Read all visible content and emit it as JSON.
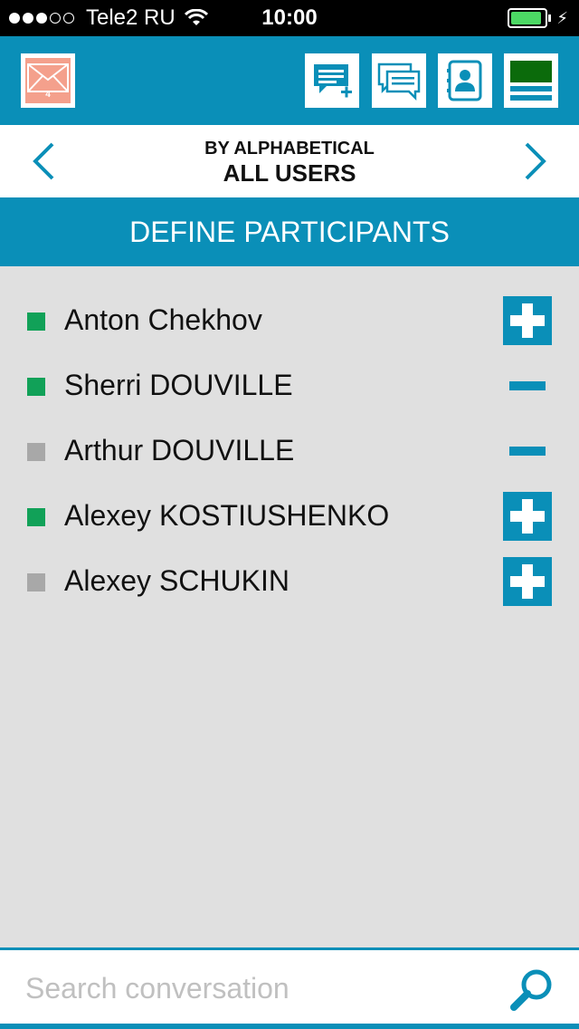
{
  "status_bar": {
    "carrier": "Tele2 RU",
    "time": "10:00",
    "signal_bars_filled": 3,
    "signal_bars_total": 5,
    "battery_level": 0.9
  },
  "toolbar": {
    "mail_badge": "4",
    "mail_icon": "envelope-icon",
    "new_chat_icon": "new-chat-icon",
    "conversations_icon": "conversations-icon",
    "contacts_icon": "contacts-icon",
    "menu_icon": "menu-icon"
  },
  "filter": {
    "sort_label": "BY ALPHABETICAL",
    "group_label": "ALL USERS"
  },
  "section": {
    "title": "DEFINE PARTICIPANTS"
  },
  "participants": [
    {
      "name": "Anton Chekhov",
      "status": "online",
      "action": "add"
    },
    {
      "name": "Sherri DOUVILLE",
      "status": "online",
      "action": "remove"
    },
    {
      "name": "Arthur DOUVILLE",
      "status": "offline",
      "action": "remove"
    },
    {
      "name": "Alexey KOSTIUSHENKO",
      "status": "online",
      "action": "add"
    },
    {
      "name": "Alexey SCHUKIN",
      "status": "offline",
      "action": "add"
    }
  ],
  "search": {
    "placeholder": "Search conversation",
    "value": ""
  },
  "colors": {
    "accent": "#0a8fb8",
    "online": "#11a158",
    "offline": "#a8a8a8",
    "mail": "#f4a08c",
    "background": "#e0e0e0"
  }
}
